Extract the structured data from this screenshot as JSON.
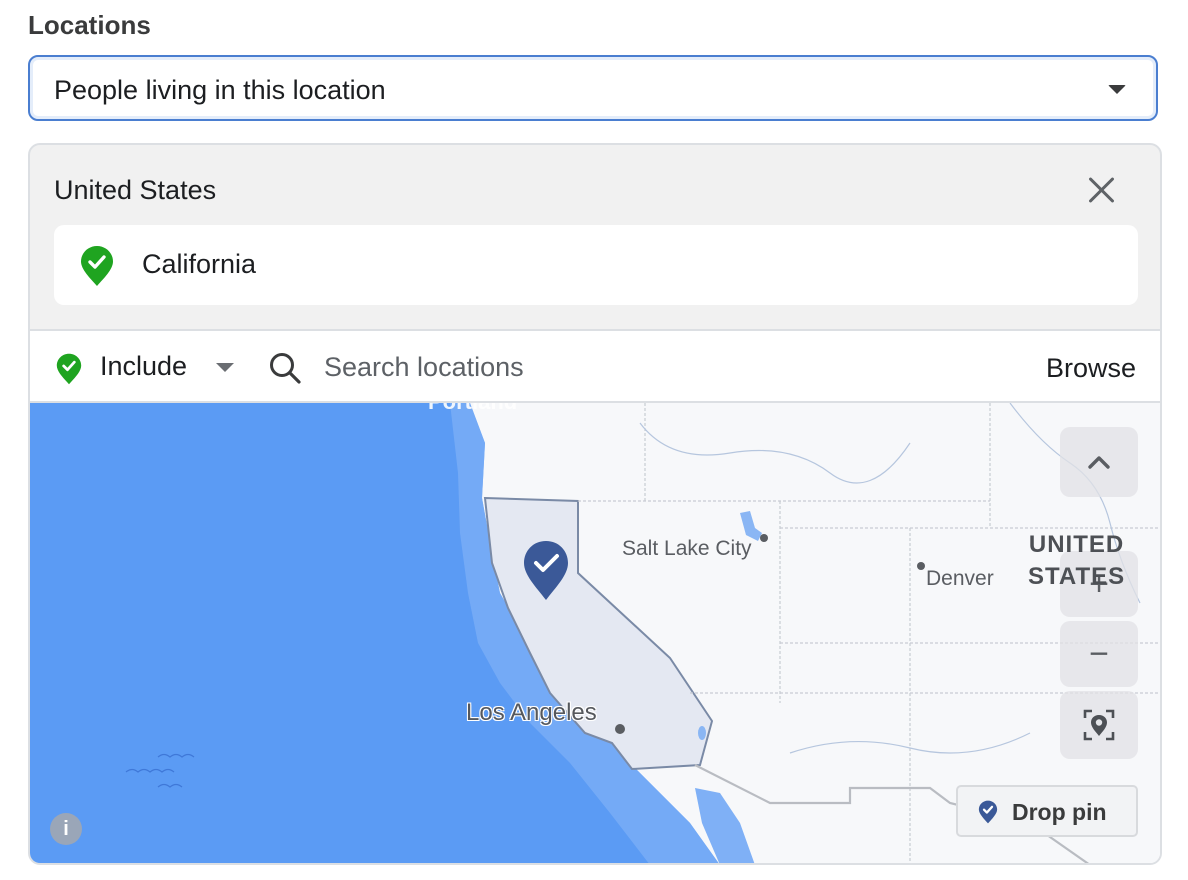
{
  "locations": {
    "label": "Locations",
    "audience_select": {
      "value": "People living in this location",
      "icon": "caret-down-icon"
    }
  },
  "selected": {
    "country": "United States",
    "close_icon": "close-icon",
    "items": [
      {
        "name": "California",
        "status": "included",
        "icon": "location-pin-check-icon",
        "color": "#1fa420"
      }
    ]
  },
  "search_bar": {
    "mode_label": "Include",
    "mode_icon": "location-pin-check-icon",
    "search_placeholder": "Search locations",
    "search_value": "",
    "browse_label": "Browse"
  },
  "map": {
    "labels": {
      "portland": "Portland",
      "salt_lake_city": "Salt Lake City",
      "denver": "Denver",
      "los_angeles": "Los Angeles",
      "country_line1": "UNITED",
      "country_line2": "STATES"
    },
    "controls": {
      "collapse_icon": "chevron-up-icon",
      "zoom_in": "+",
      "zoom_out": "−",
      "locate_icon": "locate-pin-icon"
    },
    "drop_pin_label": "Drop pin",
    "info_label": "i",
    "colors": {
      "ocean": "#5b9bf4",
      "selected_region": "#e4e8f2",
      "pin": "#3b5998"
    }
  }
}
